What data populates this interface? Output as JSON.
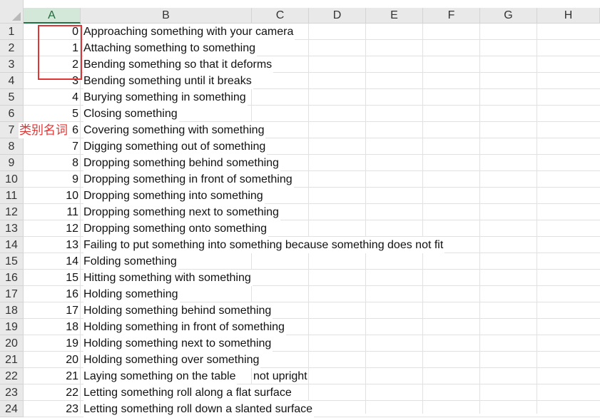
{
  "spreadsheet": {
    "columns": [
      "A",
      "B",
      "C",
      "D",
      "E",
      "F",
      "G",
      "H"
    ],
    "selected_column": "A",
    "rows": [
      {
        "row": "1",
        "id": "0",
        "label": "Approaching something with your camera"
      },
      {
        "row": "2",
        "id": "1",
        "label": "Attaching something to something"
      },
      {
        "row": "3",
        "id": "2",
        "label": "Bending something so that it deforms"
      },
      {
        "row": "4",
        "id": "3",
        "label": "Bending something until it breaks"
      },
      {
        "row": "5",
        "id": "4",
        "label": "Burying something in something"
      },
      {
        "row": "6",
        "id": "5",
        "label": "Closing something"
      },
      {
        "row": "7",
        "id": "6",
        "label": "Covering something with something"
      },
      {
        "row": "8",
        "id": "7",
        "label": "Digging something out of something"
      },
      {
        "row": "9",
        "id": "8",
        "label": "Dropping something behind something"
      },
      {
        "row": "10",
        "id": "9",
        "label": "Dropping something in front of something"
      },
      {
        "row": "11",
        "id": "10",
        "label": "Dropping something into something"
      },
      {
        "row": "12",
        "id": "11",
        "label": "Dropping something next to something"
      },
      {
        "row": "13",
        "id": "12",
        "label": "Dropping something onto something"
      },
      {
        "row": "14",
        "id": "13",
        "label": "Failing to put something into something because something does not fit"
      },
      {
        "row": "15",
        "id": "14",
        "label": "Folding something"
      },
      {
        "row": "16",
        "id": "15",
        "label": "Hitting something with something"
      },
      {
        "row": "17",
        "id": "16",
        "label": "Holding something"
      },
      {
        "row": "18",
        "id": "17",
        "label": "Holding something behind something"
      },
      {
        "row": "19",
        "id": "18",
        "label": "Holding something in front of something"
      },
      {
        "row": "20",
        "id": "19",
        "label": "Holding something next to something"
      },
      {
        "row": "21",
        "id": "20",
        "label": "Holding something over something"
      },
      {
        "row": "22",
        "id": "21",
        "label": "Laying something on the table",
        "extra": "not upright"
      },
      {
        "row": "23",
        "id": "22",
        "label": "Letting something roll along a flat surface"
      },
      {
        "row": "24",
        "id": "23",
        "label": "Letting something roll down a slanted surface"
      }
    ]
  },
  "annotation": {
    "text": "类别名词",
    "color": "#e03535"
  },
  "colors": {
    "header_bg": "#e9e9e9",
    "selected_header_bg": "#d3e8d8",
    "selected_accent": "#217346",
    "gridline": "#e1e1e1"
  }
}
